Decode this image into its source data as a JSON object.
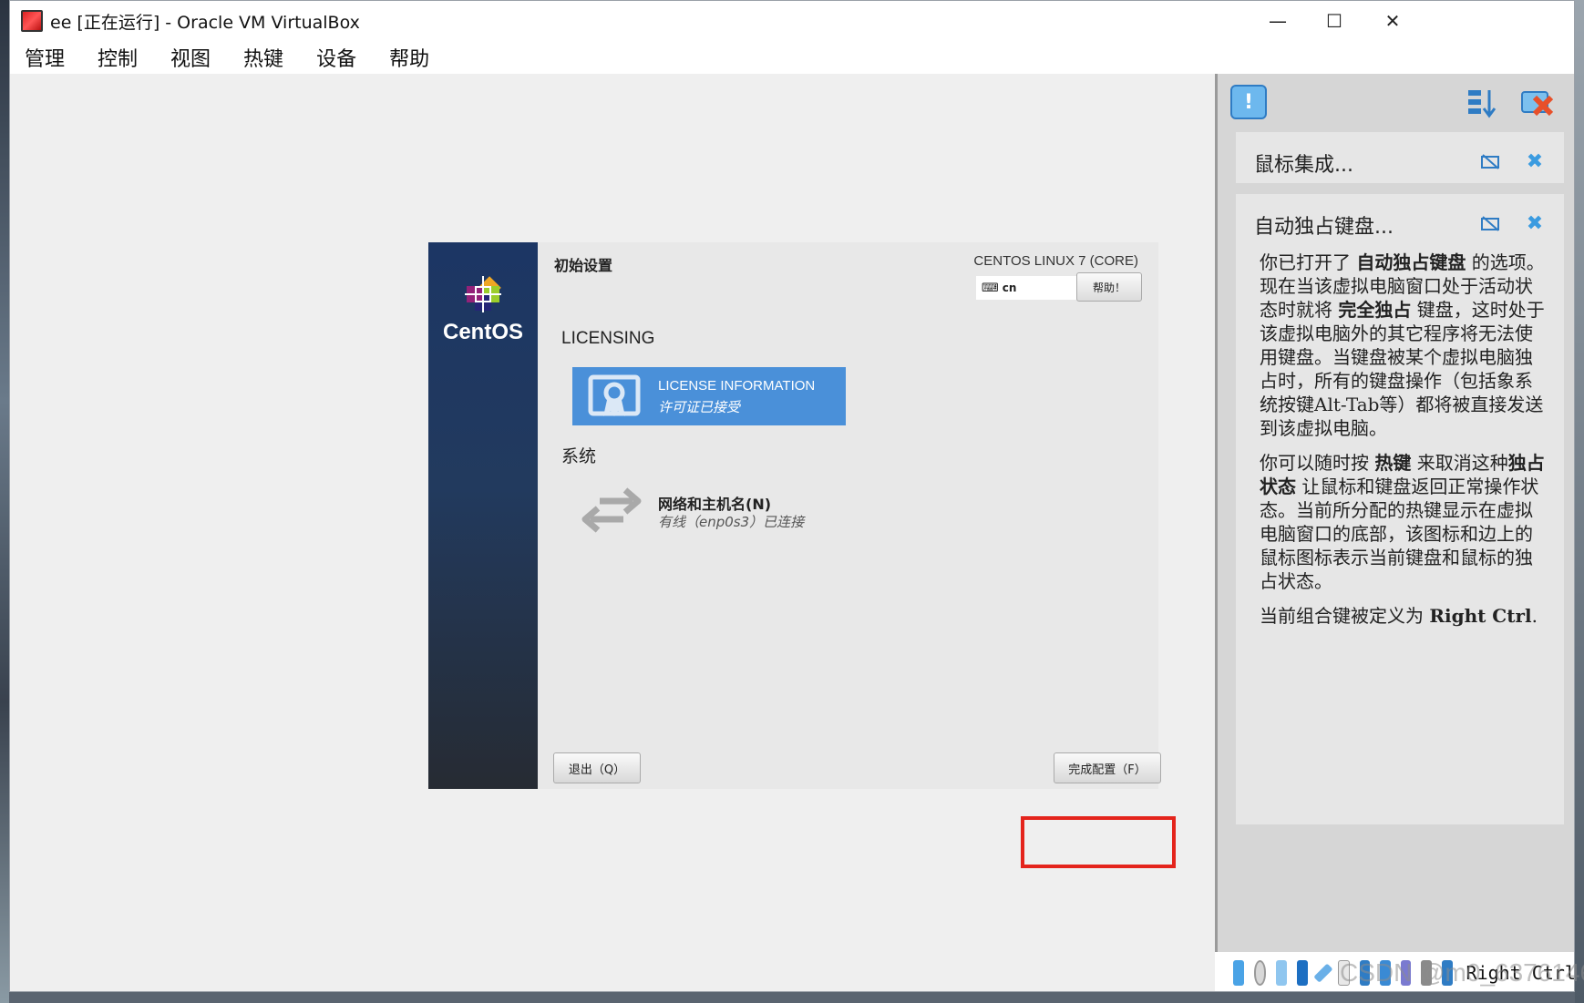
{
  "window": {
    "title": "ee [正在运行] - Oracle VM VirtualBox",
    "minimize": "—",
    "maximize": "☐",
    "close": "✕"
  },
  "menu": [
    "管理",
    "控制",
    "视图",
    "热键",
    "设备",
    "帮助"
  ],
  "installer": {
    "title": "初始设置",
    "product": "CENTOS LINUX 7 (CORE)",
    "logo_text": "CentOS",
    "keyboard_layout": "cn",
    "help_label": "帮助！",
    "section_licensing": "LICENSING",
    "license_tile": {
      "name": "LICENSE INFORMATION",
      "status": "许可证已接受"
    },
    "section_system": "系统",
    "network_tile": {
      "name": "网络和主机名(N)",
      "status": "有线（enp0s3）已连接"
    },
    "quit_label": "退出（Q）",
    "finish_label": "完成配置（F）",
    "highlight_color": "#e4241c",
    "sidebar_colors": [
      "#1c3664",
      "#262b33"
    ],
    "license_tile_color": "#4a90d9"
  },
  "notifications": {
    "card1": {
      "title": "鼠标集成..."
    },
    "card2": {
      "title": "自动独占键盘...",
      "p1_a": "你已打开了 ",
      "p1_b": "自动独占键盘",
      "p1_c": " 的选项。现在当该虚拟电脑窗口处于活动状态时就将 ",
      "p1_d": "完全独占",
      "p1_e": " 键盘，这时处于该虚拟电脑外的其它程序将无法使用键盘。当键盘被某个虚拟电脑独占时，所有的键盘操作（包括象系统按键Alt-Tab等）都将被直接发送到该虚拟电脑。",
      "p2_a": "你可以随时按 ",
      "p2_b": "热键",
      "p2_c": " 来取消这种",
      "p2_d": "独占状态",
      "p2_e": " 让鼠标和键盘返回正常操作状态。当前所分配的热键显示在虚拟电脑窗口的底部，该图标和边上的鼠标图标表示当前键盘和鼠标的独占状态。",
      "p3_a": "当前组合键被定义为 ",
      "p3_b": "Right Ctrl",
      "p3_c": "."
    }
  },
  "statusbar": {
    "icons": [
      "hard-disk-icon",
      "optical-disk-icon",
      "audio-icon",
      "network-icon",
      "usb-icon",
      "shared-folder-icon",
      "display-icon",
      "recording-icon",
      "cpu-icon",
      "mouse-capture-icon",
      "keyboard-capture-icon"
    ],
    "host_key": "Right Ctrl"
  },
  "watermark": "CSDN @m0_63761463"
}
